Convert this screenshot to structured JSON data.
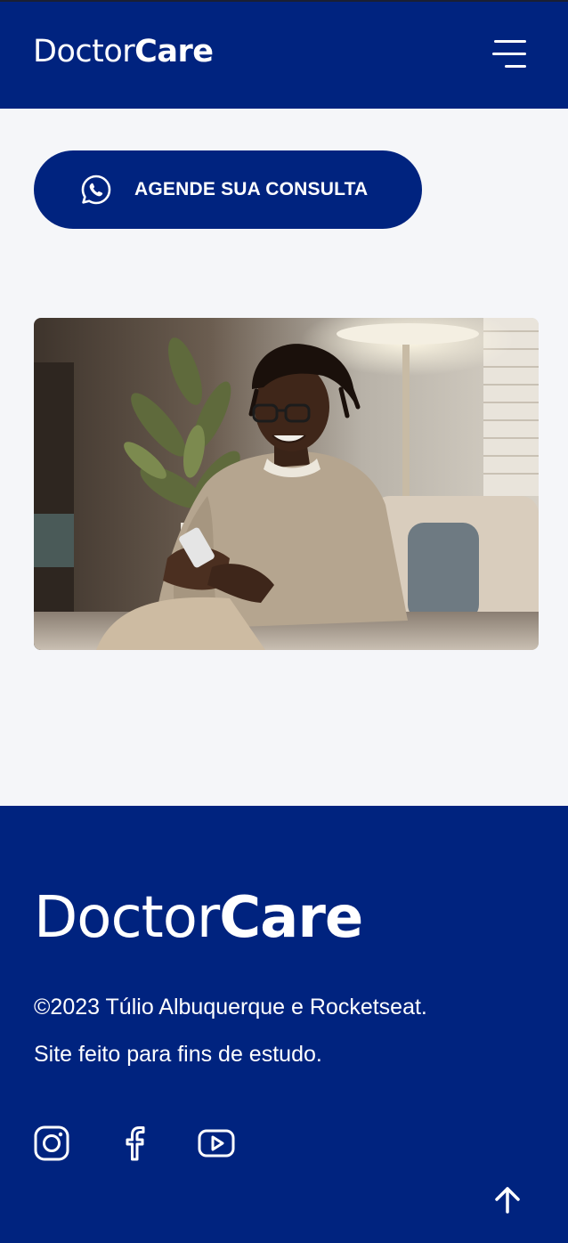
{
  "header": {
    "logo_light": "Doctor",
    "logo_bold": "Care",
    "menu_icon": "hamburger-menu-icon"
  },
  "cta": {
    "label": "AGENDE SUA CONSULTA",
    "icon": "whatsapp-icon"
  },
  "hero_image": {
    "alt": "Man smiling while using smartphone"
  },
  "footer": {
    "logo_light": "Doctor",
    "logo_bold": "Care",
    "copyright": "©2023 Túlio Albuquerque e Rocketseat.",
    "note": "Site feito para fins de estudo.",
    "social": [
      {
        "icon": "instagram-icon"
      },
      {
        "icon": "facebook-icon"
      },
      {
        "icon": "youtube-icon"
      }
    ],
    "back_to_top_icon": "arrow-up-icon"
  },
  "colors": {
    "brand": "#00237f",
    "background": "#f5f6f9",
    "text_on_brand": "#ffffff"
  }
}
